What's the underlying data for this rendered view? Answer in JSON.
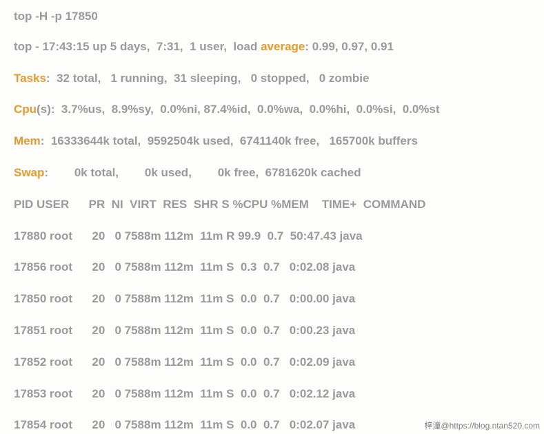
{
  "cmd": "top -H -p 17850",
  "summary": {
    "time_prefix": "top - 17:43:15 up 5 days,  7:31,  1 user,  load ",
    "avg_word": "average",
    "avg_rest": ": 0.99, 0.97, 0.91",
    "tasks_label": "Tasks",
    "tasks_rest": ":  32 total,   1 running,  31 sleeping,   0 stopped,   0 zombie",
    "cpu_label": "Cpu",
    "cpu_rest": "(s):  3.7%us,  8.9%sy,  0.0%ni, 87.4%id,  0.0%wa,  0.0%hi,  0.0%si,  0.0%st",
    "mem_label": "Mem",
    "mem_rest": ":  16333644k total,  9592504k used,  6741140k free,   165700k buffers",
    "swap_label": "Swap",
    "swap_rest": ":        0k total,        0k used,        0k free,  6781620k cached"
  },
  "header": "PID USER      PR  NI  VIRT  RES  SHR S %CPU %MEM    TIME+  COMMAND",
  "rows": [
    "17880 root      20   0 7588m 112m  11m R 99.9  0.7  50:47.43 java",
    "17856 root      20   0 7588m 112m  11m S  0.3  0.7   0:02.08 java",
    "17850 root      20   0 7588m 112m  11m S  0.0  0.7   0:00.00 java",
    "17851 root      20   0 7588m 112m  11m S  0.0  0.7   0:00.23 java",
    "17852 root      20   0 7588m 112m  11m S  0.0  0.7   0:02.09 java",
    "17853 root      20   0 7588m 112m  11m S  0.0  0.7   0:02.12 java",
    "17854 root      20   0 7588m 112m  11m S  0.0  0.7   0:02.07 java"
  ],
  "watermark": "梓潼@https://blog.ntan520.com"
}
